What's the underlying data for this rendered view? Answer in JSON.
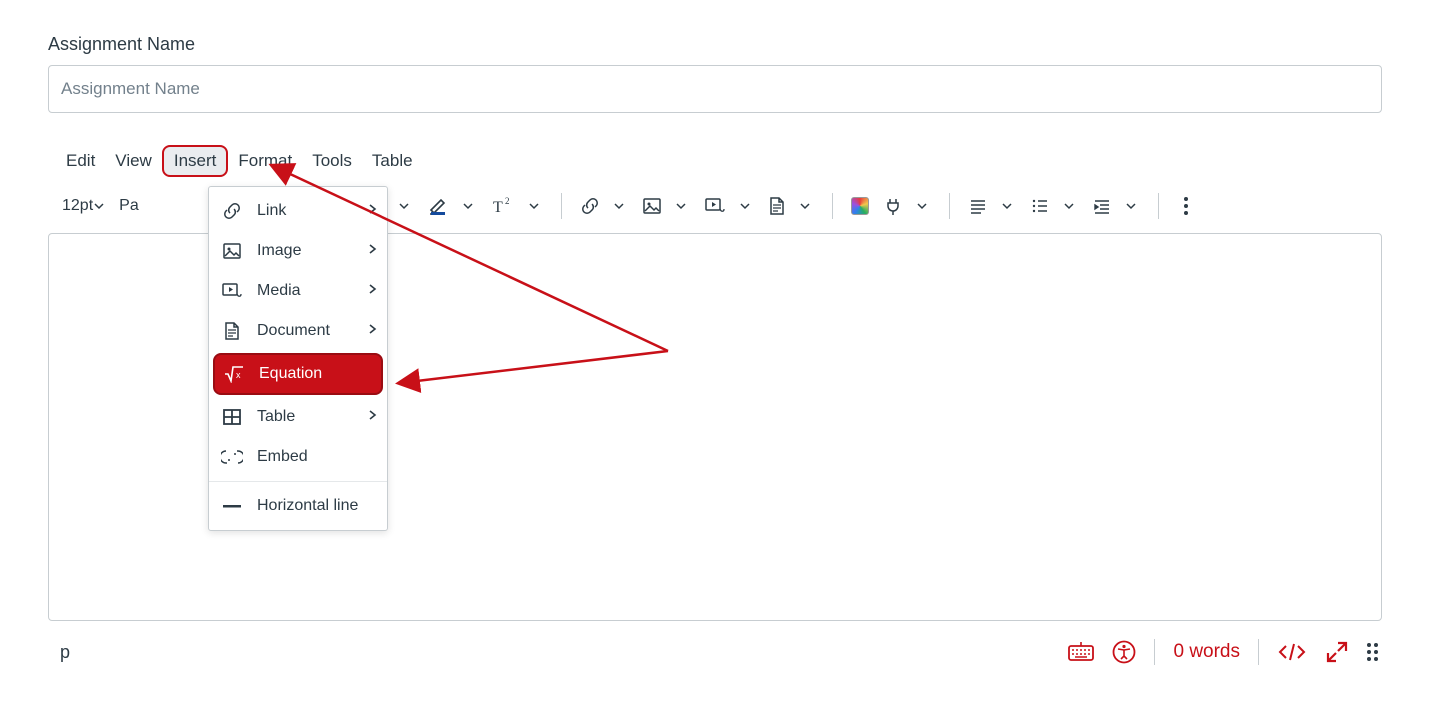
{
  "form": {
    "label": "Assignment Name",
    "placeholder": "Assignment Name",
    "value": ""
  },
  "menubar": {
    "items": [
      "Edit",
      "View",
      "Insert",
      "Format",
      "Tools",
      "Table"
    ],
    "active_index": 2
  },
  "toolbar": {
    "font_size": "12pt",
    "paragraph_style": "Pa"
  },
  "insert_menu": {
    "items": [
      {
        "label": "Link",
        "icon": "link-icon",
        "submenu": true
      },
      {
        "label": "Image",
        "icon": "image-icon",
        "submenu": true
      },
      {
        "label": "Media",
        "icon": "media-icon",
        "submenu": true
      },
      {
        "label": "Document",
        "icon": "document-icon",
        "submenu": true
      },
      {
        "label": "Equation",
        "icon": "equation-icon",
        "submenu": false,
        "highlight": true
      },
      {
        "label": "Table",
        "icon": "table-icon",
        "submenu": true
      },
      {
        "label": "Embed",
        "icon": "embed-icon",
        "submenu": false
      }
    ],
    "separator_after": 6,
    "footer_item": {
      "label": "Horizontal line",
      "icon": "hr-icon"
    }
  },
  "status": {
    "element_path": "p",
    "word_count": "0 words"
  },
  "colors": {
    "accent": "#C81018",
    "border": "#C7CDD1",
    "text": "#2D3B45"
  }
}
